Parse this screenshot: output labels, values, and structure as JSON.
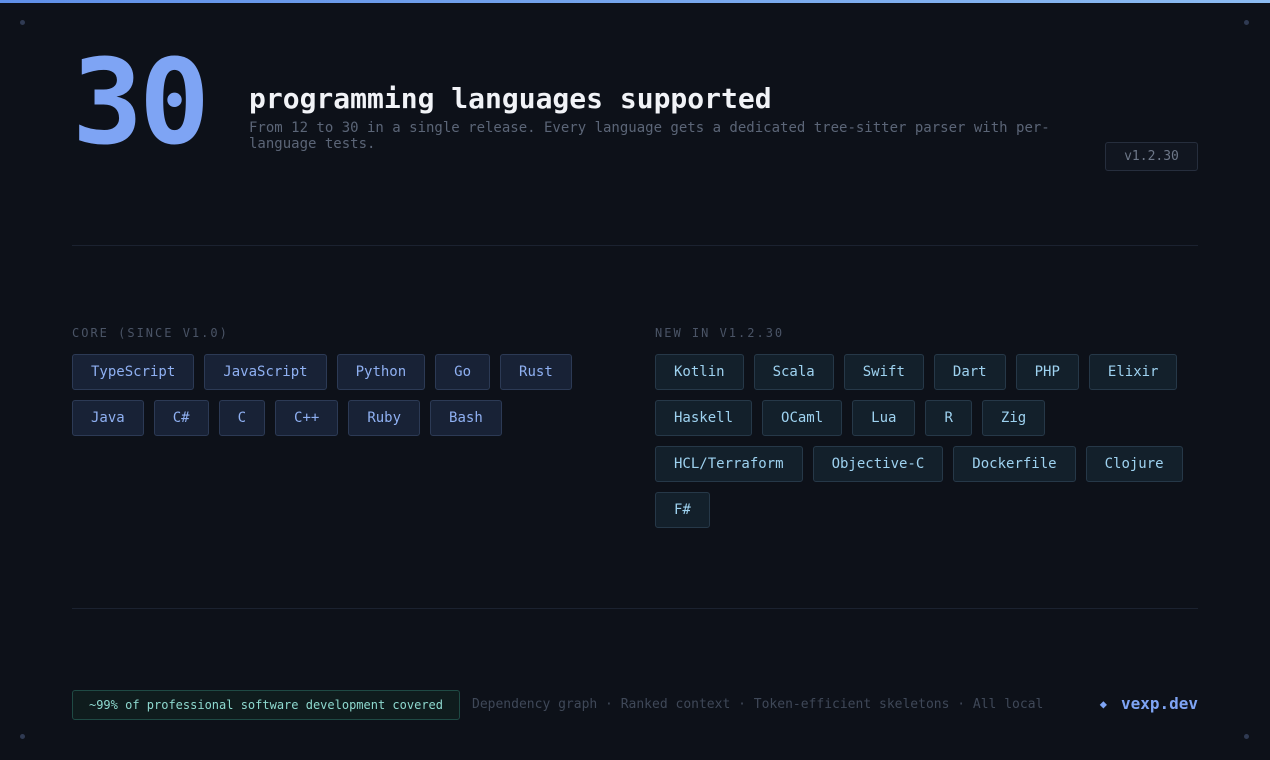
{
  "hero": {
    "number": "30",
    "title": "programming languages supported",
    "description": "From 12 to 30 in a single release. Every language gets a dedicated tree-sitter parser with per-language tests.",
    "version": "v1.2.30"
  },
  "core": {
    "label": "CORE (SINCE V1.0)",
    "languages": [
      "TypeScript",
      "JavaScript",
      "Python",
      "Go",
      "Rust",
      "Java",
      "C#",
      "C",
      "C++",
      "Ruby",
      "Bash"
    ]
  },
  "new": {
    "label": "NEW IN V1.2.30",
    "languages": [
      "Kotlin",
      "Scala",
      "Swift",
      "Dart",
      "PHP",
      "Elixir",
      "Haskell",
      "OCaml",
      "Lua",
      "R",
      "Zig",
      "HCL/Terraform",
      "Objective-C",
      "Dockerfile",
      "Clojure",
      "F#"
    ]
  },
  "footer": {
    "coverage": "~99% of professional software development covered",
    "features": "Dependency graph · Ranked context · Token-efficient skeletons · All local",
    "brand_icon": "diamond-icon",
    "brand": "vexp.dev"
  },
  "colors": {
    "accent": "#7ea4f4",
    "background": "#0d1119",
    "coverage": "#8ed9cf"
  }
}
